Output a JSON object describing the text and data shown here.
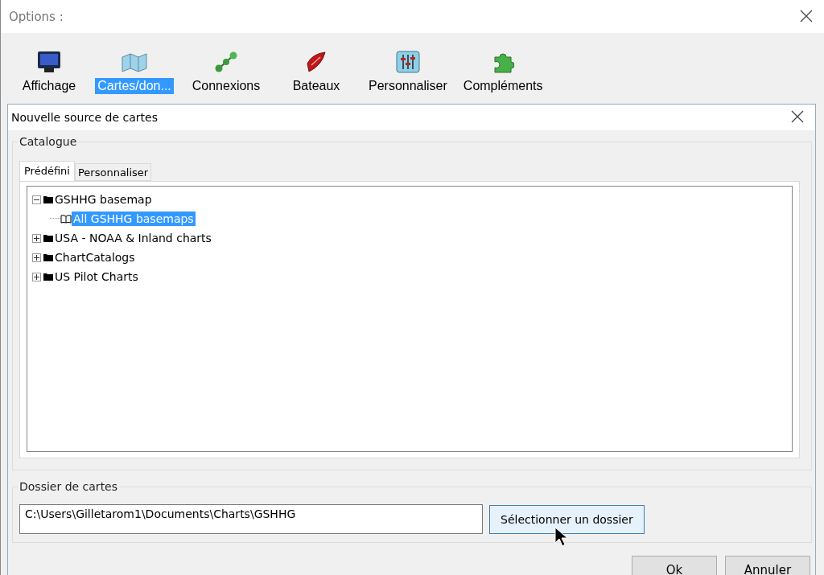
{
  "window": {
    "title": "Options :"
  },
  "toolbar": [
    {
      "label": "Affichage",
      "selected": false
    },
    {
      "label": "Cartes/don...",
      "selected": true
    },
    {
      "label": "Connexions",
      "selected": false
    },
    {
      "label": "Bateaux",
      "selected": false
    },
    {
      "label": "Personnaliser",
      "selected": false
    },
    {
      "label": "Compléments",
      "selected": false
    }
  ],
  "dialog": {
    "title": "Nouvelle source de cartes",
    "catalogue": {
      "legend": "Catalogue",
      "tabs": [
        {
          "label": "Prédéfini",
          "selected": true
        },
        {
          "label": "Personnaliser",
          "selected": false
        }
      ],
      "tree": [
        {
          "label": "GSHHG basemap",
          "kind": "folder",
          "expanded": true,
          "selected": false,
          "children": [
            {
              "label": "All GSHHG basemaps",
              "kind": "book",
              "selected": true
            }
          ]
        },
        {
          "label": "USA - NOAA & Inland charts",
          "kind": "folder",
          "expanded": false,
          "selected": false
        },
        {
          "label": "ChartCatalogs",
          "kind": "folder",
          "expanded": false,
          "selected": false
        },
        {
          "label": "US Pilot Charts",
          "kind": "folder",
          "expanded": false,
          "selected": false
        }
      ]
    },
    "folder": {
      "legend": "Dossier de cartes",
      "path": "C:\\Users\\Gilletarom1\\Documents\\Charts\\GSHHG",
      "button": "Sélectionner un dossier"
    },
    "buttons": [
      "Ok",
      "Annuler"
    ]
  }
}
